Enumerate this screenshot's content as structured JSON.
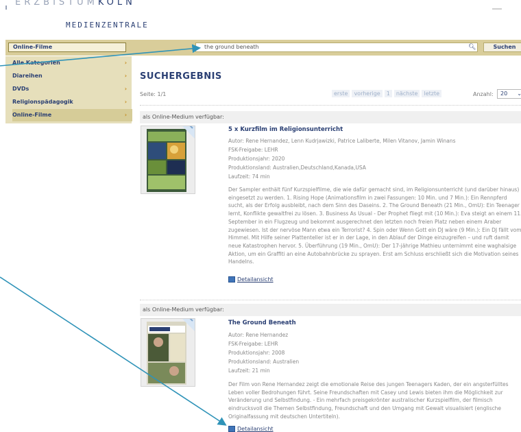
{
  "header": {
    "logo_line1_prefix": "ERZBISTUM",
    "logo_line1_suffix": "KÖLN",
    "logo_line2": "MEDIENZENTRALE"
  },
  "search": {
    "category": "Online-Filme",
    "query": "the ground beneath",
    "icon": "search-icon",
    "button_label": "Suchen"
  },
  "sidebar": {
    "items": [
      {
        "label": "Alle Kategorien"
      },
      {
        "label": "Diareihen"
      },
      {
        "label": "DVDs"
      },
      {
        "label": "Religionspädagogik"
      },
      {
        "label": "Online-Filme"
      }
    ],
    "chevron": "›"
  },
  "main": {
    "title": "SUCHERGEBNIS",
    "page_info": "Seite: 1/1",
    "pager": {
      "first": "erste",
      "prev": "vorherige",
      "current": "1",
      "next": "nächste",
      "last": "letzte"
    },
    "count_label": "Anzahl:",
    "count_value": "20"
  },
  "results": [
    {
      "availability": "als Online-Medium verfügbar:",
      "title": "5 x Kurzfilm im Religionsunterricht",
      "author": "Autor: Rene Hernandez, Lenn Kudrjawizki, Patrice Laliberte, Milen Vitanov, Jamin Winans",
      "fsk": "FSK-Freigabe: LEHR",
      "year": "Produktionsjahr: 2020",
      "country": "Produktionsland: Australien,Deutschland,Kanada,USA",
      "runtime": "Laufzeit: 74 min",
      "description": "Der Sampler enthält fünf Kurzspielfilme, die wie dafür gemacht sind, im Religionsunterricht (und darüber hinaus) eingesetzt zu werden. 1. Rising Hope (Animationsfilm in zwei Fassungen: 10 Min. und 7 Min.): Ein Rennpferd sucht, als der Erfolg ausbleibt, nach dem Sinn des Daseins. 2. The Ground Beneath (21 Min., OmU): Ein Teenager lernt, Konflikte gewaltfrei zu lösen. 3. Business As Usual - Der Prophet fliegt mit (10 Min.): Eva steigt an einem 11. September in ein Flugzeug und bekommt ausgerechnet den letzten noch freien Platz neben einem Araber zugewiesen. Ist der nervöse Mann etwa ein Terrorist? 4. Spin oder Wenn Gott ein DJ wäre (9 Min.): Ein DJ fällt vom Himmel. Mit Hilfe seiner Plattenteller ist er in der Lage, in den Ablauf der Dinge einzugreifen – und ruft damit neue Katastrophen hervor. 5. Überführung (19 Min., OmU): Der 17-jährige Mathieu unternimmt eine waghalsige Aktion, um ein Graffiti an eine Autobahnbrücke zu sprayen. Erst am Schluss erschließt sich die Motivation seines Handelns.",
      "detail_label": "Detailansicht"
    },
    {
      "availability": "als Online-Medium verfügbar:",
      "title": "The Ground Beneath",
      "author": "Autor: Rene Hernandez",
      "fsk": "FSK-Freigabe: LEHR",
      "year": "Produktionsjahr: 2008",
      "country": "Produktionsland: Australien",
      "runtime": "Laufzeit: 21 min",
      "description": "Der Film von Rene Hernandez zeigt die emotionale Reise des jungen Teenagers Kaden, der ein angsterfülltes Leben voller Bedrohungen führt. Seine Freundschaften mit Casey und Lewis bieten ihm die Möglichkeit zur Veränderung und Selbstfindung. - Ein mehrfach preisgekrönter australischer Kurzspielfilm, der filmisch eindrucksvoll die Themen Selbstfindung, Freundschaft und den Umgang mit Gewalt visualisiert (englische Originalfassung mit deutschen Untertiteln).",
      "detail_label": "Detailansicht"
    }
  ],
  "colors": {
    "navy": "#2a3f73",
    "khaki": "#d9cd9a",
    "sidebar": "#e6dfbb",
    "arrow": "#2f93b8"
  }
}
